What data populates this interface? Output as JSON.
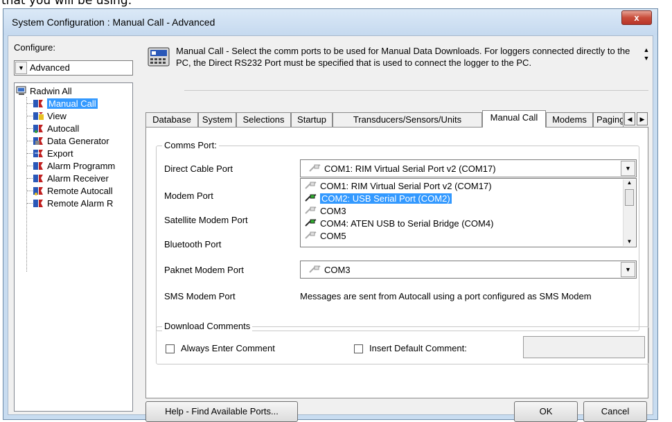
{
  "document_fragment": "that you will be using:",
  "window": {
    "title": "System Configuration : Manual Call - Advanced",
    "close_label": "x"
  },
  "configure": {
    "label": "Configure:",
    "selected": "Advanced"
  },
  "tree": {
    "root": "Radwin All",
    "items": [
      {
        "label": "Manual Call",
        "icon": "manual-call-icon",
        "selected": true
      },
      {
        "label": "View",
        "icon": "view-icon"
      },
      {
        "label": "Autocall",
        "icon": "autocall-icon"
      },
      {
        "label": "Data Generator",
        "icon": "data-generator-icon"
      },
      {
        "label": "Export",
        "icon": "export-icon"
      },
      {
        "label": "Alarm Programm",
        "icon": "alarm-programmer-icon"
      },
      {
        "label": "Alarm Receiver",
        "icon": "alarm-receiver-icon"
      },
      {
        "label": "Remote Autocall",
        "icon": "remote-autocall-icon"
      },
      {
        "label": "Remote Alarm R",
        "icon": "remote-alarm-icon"
      }
    ]
  },
  "description": "Manual Call - Select the comm ports to be used for Manual Data Downloads. For loggers connected directly to the PC, the Direct RS232 Port must be specified that is used to connect the logger to the PC.",
  "tabs": [
    "Database",
    "System",
    "Selections",
    "Startup",
    "Transducers/Sensors/Units",
    "Manual Call",
    "Modems",
    "Paging"
  ],
  "active_tab": "Manual Call",
  "comms": {
    "group_title": "Comms Port:",
    "direct_cable_label": "Direct Cable Port",
    "direct_cable_value": "COM1: RIM Virtual Serial Port v2 (COM17)",
    "modem_label": "Modem Port",
    "satellite_label": "Satellite Modem Port",
    "bluetooth_label": "Bluetooth Port",
    "paknet_label": "Paknet Modem Port",
    "paknet_value": "COM3",
    "sms_label": "SMS Modem Port",
    "sms_text": "Messages are sent from Autocall using a port configured as SMS Modem",
    "dropdown_options": [
      {
        "label": "COM1: RIM Virtual Serial Port v2 (COM17)",
        "active": false
      },
      {
        "label": "COM2: USB Serial Port (COM2)",
        "active": true,
        "selected": true
      },
      {
        "label": "COM3",
        "active": false
      },
      {
        "label": "COM4: ATEN USB to Serial Bridge (COM4)",
        "active": true
      },
      {
        "label": "COM5",
        "active": false
      }
    ]
  },
  "download": {
    "group_title": "Download Comments",
    "always_enter": "Always Enter Comment",
    "insert_default": "Insert Default Comment:"
  },
  "buttons": {
    "help": "Help - Find Available Ports...",
    "ok": "OK",
    "cancel": "Cancel"
  },
  "colors": {
    "selection": "#3399ff",
    "tree_icon_blue": "#2a58b8",
    "tree_icon_red": "#c02020",
    "close_red": "#c94d3a"
  }
}
